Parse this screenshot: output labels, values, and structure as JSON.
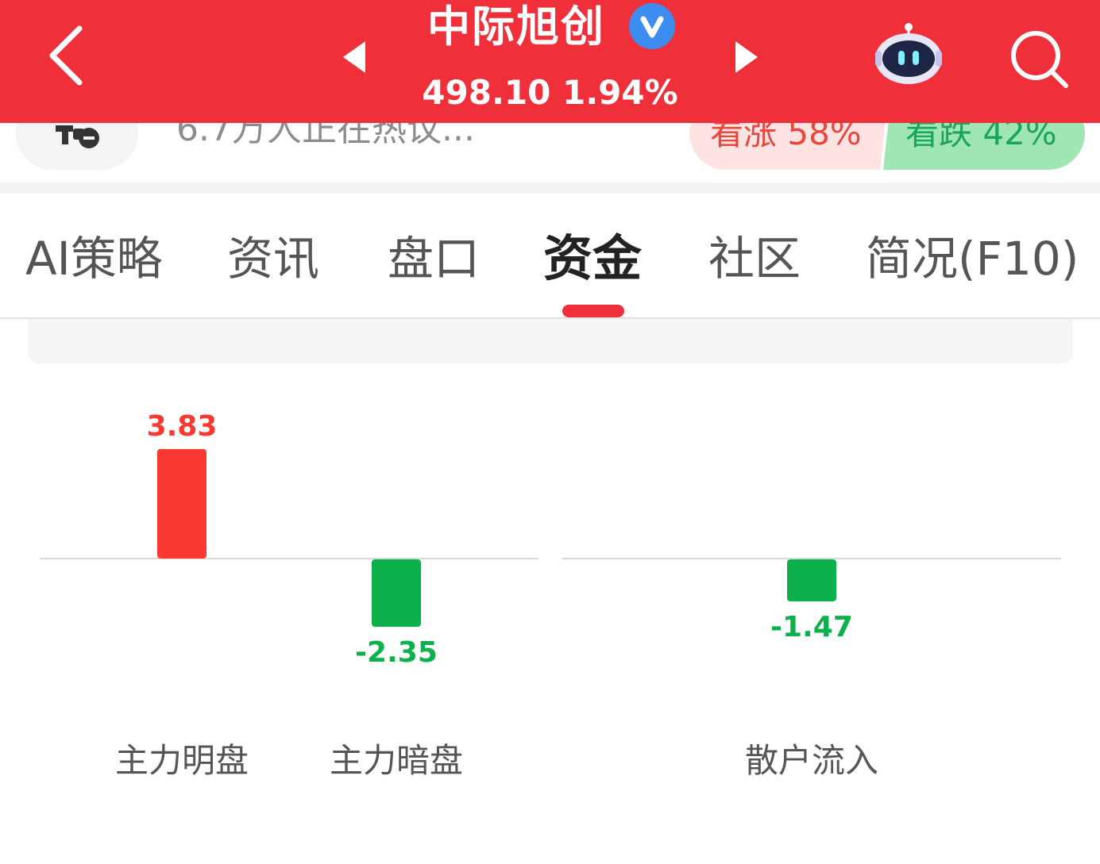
{
  "header": {
    "stock_name": "中际旭创",
    "verified_badge": "V",
    "quote": "498.10 1.94%",
    "icons": {
      "back": "back-arrow-icon",
      "prev": "prev-stock-icon",
      "next": "next-stock-icon",
      "assistant": "robot-assistant-icon",
      "search": "search-icon"
    }
  },
  "discussion": {
    "text": "6.7万人正在热议...",
    "bullish": "看涨 58%",
    "bearish": "看跌 42%"
  },
  "tabs": [
    {
      "label": "AI策略"
    },
    {
      "label": "资讯"
    },
    {
      "label": "盘口"
    },
    {
      "label": "资金",
      "active": true
    },
    {
      "label": "社区"
    },
    {
      "label": "简况(F10)"
    }
  ],
  "chart_data": {
    "type": "bar",
    "categories": [
      "主力明盘",
      "主力暗盘",
      "散户流入"
    ],
    "values": [
      3.83,
      -2.35,
      -1.47
    ],
    "value_labels": [
      "3.83",
      "-2.35",
      "-1.47"
    ],
    "colors": {
      "positive": "#fa3a32",
      "negative": "#0db14b"
    }
  }
}
